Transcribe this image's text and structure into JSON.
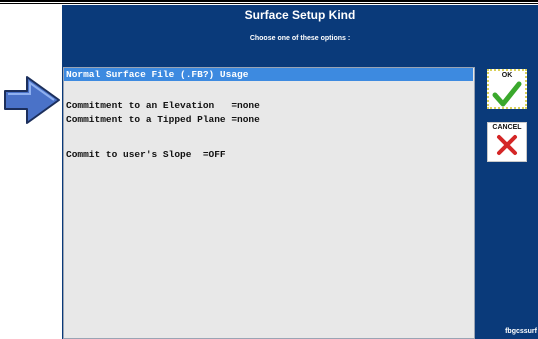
{
  "dialog": {
    "title": "Surface Setup Kind",
    "subtitle": "Choose one of these options :"
  },
  "options": [
    {
      "label": "Normal Surface File (.FB?) Usage",
      "selected": true
    },
    {
      "label": "",
      "selected": false
    },
    {
      "label": "Commitment to an Elevation   =none",
      "selected": false
    },
    {
      "label": "Commitment to a Tipped Plane =none",
      "selected": false
    },
    {
      "label": "",
      "selected": false
    },
    {
      "label": "Commit to user's Slope  =OFF",
      "selected": false
    }
  ],
  "buttons": {
    "ok_label": "OK",
    "cancel_label": "CANCEL"
  },
  "footer": {
    "form_id": "fbgcssurf"
  },
  "colors": {
    "panel_bg": "#0a3a7a",
    "selection": "#3d8ae0",
    "arrow": "#4a72c8",
    "ok_check": "#3aa82c",
    "cancel_x": "#d42626"
  },
  "icons": {
    "pointer": "arrow-right-icon",
    "ok": "check-icon",
    "cancel": "x-icon"
  }
}
